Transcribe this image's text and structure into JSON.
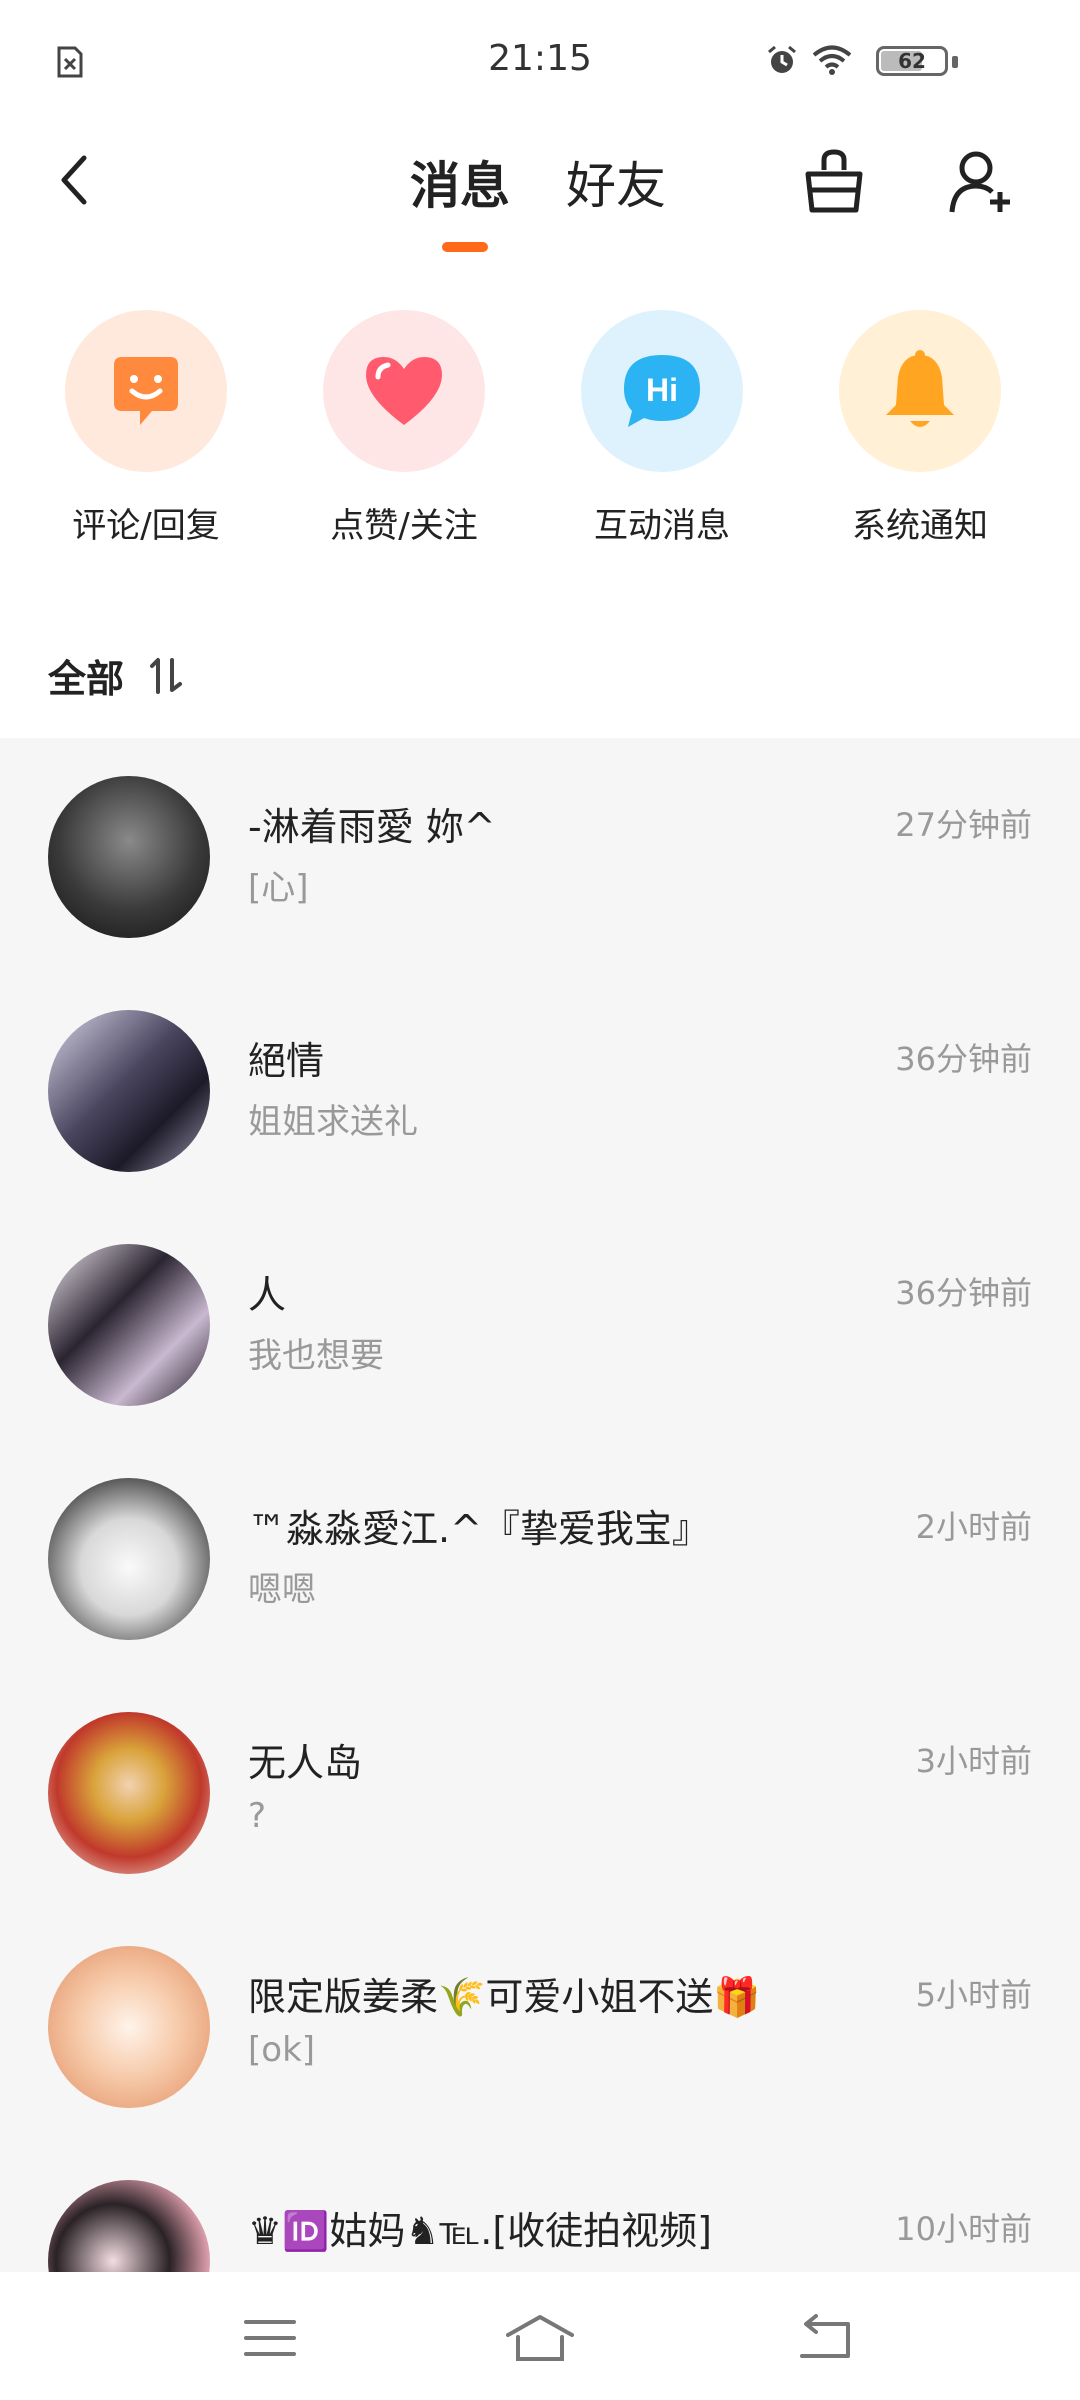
{
  "status_bar": {
    "time": "21:15",
    "battery": "62",
    "left_icon": "sim-missing-icon",
    "alarm_icon": "alarm-icon",
    "wifi_icon": "wifi-icon"
  },
  "header": {
    "tabs": [
      {
        "label": "消息",
        "active": true
      },
      {
        "label": "好友",
        "active": false
      }
    ],
    "accent_color": "#ff6a1a"
  },
  "categories": [
    {
      "label": "评论/回复",
      "icon": "comment-smile-icon",
      "bg": "#ffe9dc",
      "color": "#ff8a3d"
    },
    {
      "label": "点赞/关注",
      "icon": "heart-icon",
      "bg": "#ffe6e6",
      "color": "#ff5a6e"
    },
    {
      "label": "互动消息",
      "icon": "hi-bubble-icon",
      "bg": "#ddf2fd",
      "color": "#2bb3f3"
    },
    {
      "label": "系统通知",
      "icon": "bell-icon",
      "bg": "#fff0d6",
      "color": "#ffa521"
    }
  ],
  "section": {
    "title": "全部",
    "sort_icon": "sort-icon"
  },
  "messages": [
    {
      "name": "-淋着雨愛 妳^",
      "preview": "[心]",
      "time": "27分钟前"
    },
    {
      "name": "絕情",
      "preview": "姐姐求送礼",
      "time": "36分钟前"
    },
    {
      "name": "人",
      "preview": "我也想要",
      "time": "36分钟前"
    },
    {
      "name": "™淼淼愛江.^『挚爱我宝』",
      "preview": "嗯嗯",
      "time": "2小时前"
    },
    {
      "name": "无人岛",
      "preview": "?",
      "time": "3小时前"
    },
    {
      "name": "限定版姜柔🌾可爱小姐不送🎁",
      "preview": "[ok]",
      "time": "5小时前"
    },
    {
      "name": "♛🆔姑妈♞℡.[收徒拍视频]",
      "preview": "",
      "time": "10小时前"
    }
  ],
  "navbar": {
    "menu_icon": "menu-icon",
    "home_icon": "home-icon",
    "back_icon": "back-icon"
  }
}
